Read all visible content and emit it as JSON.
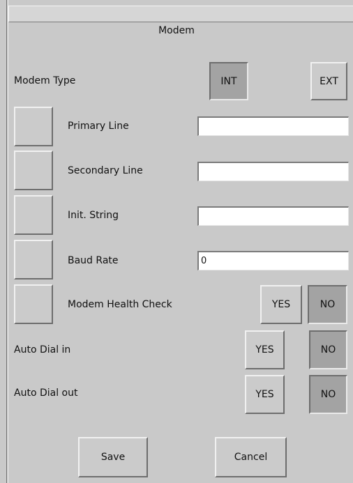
{
  "dialog": {
    "title": "Modem",
    "modem_type": {
      "label": "Modem Type",
      "int_label": "INT",
      "ext_label": "EXT"
    },
    "primary_line": {
      "label": "Primary Line",
      "value": ""
    },
    "secondary_line": {
      "label": "Secondary Line",
      "value": ""
    },
    "init_string": {
      "label": "Init. String",
      "value": ""
    },
    "baud_rate": {
      "label": "Baud Rate",
      "value": "0"
    },
    "health_check": {
      "label": "Modem Health Check",
      "yes_label": "YES",
      "no_label": "NO"
    },
    "auto_dial_in": {
      "label": "Auto Dial in",
      "yes_label": "YES",
      "no_label": "NO"
    },
    "auto_dial_out": {
      "label": "Auto Dial out",
      "yes_label": "YES",
      "no_label": "NO"
    },
    "save_label": "Save",
    "cancel_label": "Cancel"
  }
}
